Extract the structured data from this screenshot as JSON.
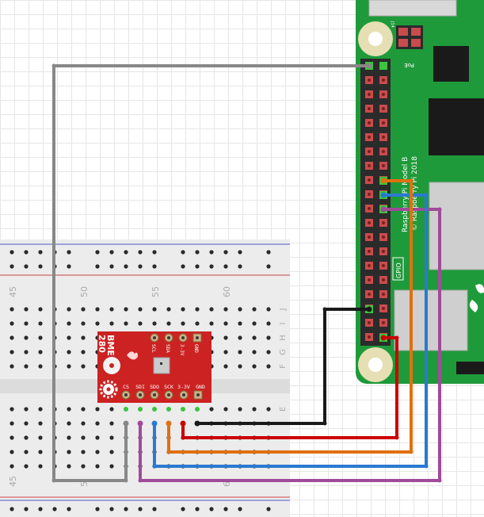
{
  "breadboard": {
    "column_labels": [
      "45",
      "50",
      "55",
      "60"
    ],
    "bottom_column_labels": [
      "45",
      "5",
      "6"
    ],
    "row_labels_top": [
      "J",
      "I",
      "H",
      "G",
      "F"
    ],
    "row_labels_bottom": [
      "E"
    ]
  },
  "sensor": {
    "name_line1": "BME",
    "name_line2": "280",
    "top_pins": [
      "SCL",
      "SDA",
      "3-3V",
      "GND"
    ],
    "bottom_pins": [
      "CS",
      "SDI",
      "SDO",
      "SCK",
      "3-3V",
      "GND"
    ]
  },
  "pi": {
    "model_text": "Raspberry Pi Model B",
    "copyright_text": "© Raspberry Pi 2018",
    "gpio_label": "GPIO",
    "poe_label": "PoE",
    "j14_label": "J14"
  },
  "wires": [
    {
      "name": "gnd-wire",
      "color": "#1a1a1a"
    },
    {
      "name": "power-wire",
      "color": "#cc0000"
    },
    {
      "name": "sck-wire",
      "color": "#e07010"
    },
    {
      "name": "sdo-wire",
      "color": "#2a7ad0"
    },
    {
      "name": "sdi-wire",
      "color": "#a04a9a"
    },
    {
      "name": "cs-wire",
      "color": "#888888"
    }
  ],
  "colors": {
    "pi_board": "#1f9a3a",
    "sensor_board": "#cc2222",
    "breadboard": "#ececec"
  }
}
